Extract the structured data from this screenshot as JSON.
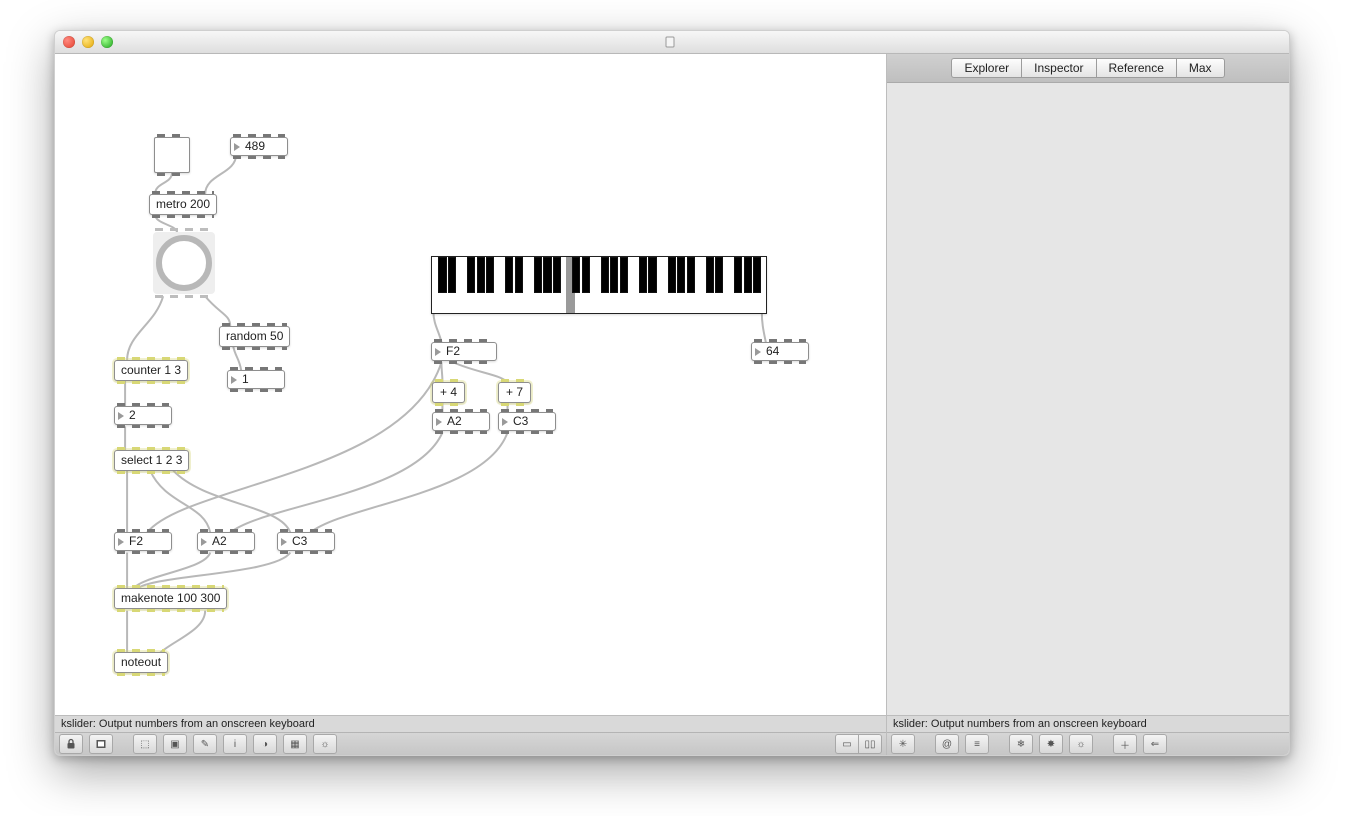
{
  "title": "",
  "sidebar": {
    "tabs": [
      "Explorer",
      "Inspector",
      "Reference",
      "Max"
    ]
  },
  "status_left": "kslider: Output numbers from an onscreen keyboard",
  "status_right": "kslider: Output numbers from an onscreen keyboard",
  "objects": {
    "metro": "metro 200",
    "random": "random 50",
    "counter": "counter 1 3",
    "select": "select 1 2 3",
    "plus4": "+ 4",
    "plus7": "+ 7",
    "makenote": "makenote 100 300",
    "noteout": "noteout"
  },
  "numbers": {
    "n489": "489",
    "n1": "1",
    "n2": "2",
    "nF2a": "F2",
    "n64": "64",
    "nA2a": "A2",
    "nC3a": "C3",
    "nF2b": "F2",
    "nA2b": "A2",
    "nC3b": "C3"
  },
  "kslider": {
    "white_keys": 35,
    "selected_white_index": 14
  }
}
